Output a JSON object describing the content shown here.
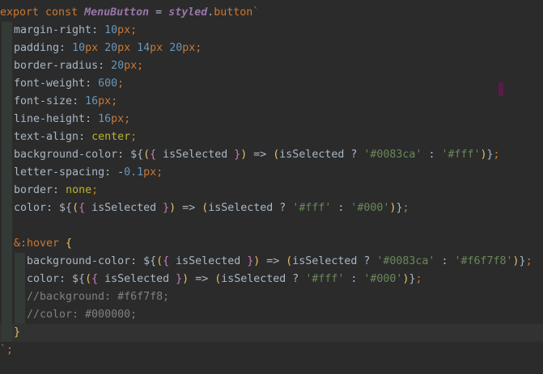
{
  "lines": [
    [
      [
        "kw",
        "export "
      ],
      [
        "kw",
        "const "
      ],
      [
        "fn",
        "MenuButton"
      ],
      [
        "plain",
        " = "
      ],
      [
        "fn",
        "styled"
      ],
      [
        "plain",
        "."
      ],
      [
        "kw",
        "button"
      ],
      [
        "tick",
        "`"
      ]
    ],
    [
      [
        "prop",
        "margin-right"
      ],
      [
        "plain",
        ": "
      ],
      [
        "num",
        "10"
      ],
      [
        "kw",
        "px"
      ],
      [
        "kw",
        ";"
      ]
    ],
    [
      [
        "prop",
        "padding"
      ],
      [
        "plain",
        ": "
      ],
      [
        "num",
        "10"
      ],
      [
        "kw",
        "px "
      ],
      [
        "num",
        "20"
      ],
      [
        "kw",
        "px "
      ],
      [
        "num",
        "14"
      ],
      [
        "kw",
        "px "
      ],
      [
        "num",
        "20"
      ],
      [
        "kw",
        "px"
      ],
      [
        "kw",
        ";"
      ]
    ],
    [
      [
        "prop",
        "border-radius"
      ],
      [
        "plain",
        ": "
      ],
      [
        "num",
        "20"
      ],
      [
        "kw",
        "px"
      ],
      [
        "kw",
        ";"
      ]
    ],
    [
      [
        "prop",
        "font-weight"
      ],
      [
        "plain",
        ": "
      ],
      [
        "num",
        "600"
      ],
      [
        "kw",
        ";"
      ]
    ],
    [
      [
        "prop",
        "font-size"
      ],
      [
        "plain",
        ": "
      ],
      [
        "num",
        "16"
      ],
      [
        "kw",
        "px"
      ],
      [
        "kw",
        ";"
      ]
    ],
    [
      [
        "prop",
        "line-height"
      ],
      [
        "plain",
        ": "
      ],
      [
        "num",
        "16"
      ],
      [
        "kw",
        "px"
      ],
      [
        "kw",
        ";"
      ]
    ],
    [
      [
        "prop",
        "text-align"
      ],
      [
        "plain",
        ": "
      ],
      [
        "val",
        "center"
      ],
      [
        "kw",
        ";"
      ]
    ],
    [
      [
        "prop",
        "background-color"
      ],
      [
        "plain",
        ": ${"
      ],
      [
        "br1",
        "("
      ],
      [
        "br2",
        "{ "
      ],
      [
        "plain",
        "isSelected "
      ],
      [
        "br2",
        "}"
      ],
      [
        "br1",
        ")"
      ],
      [
        "plain",
        " => "
      ],
      [
        "br1",
        "("
      ],
      [
        "plain",
        "isSelected ? "
      ],
      [
        "str",
        "'#0083ca'"
      ],
      [
        "plain",
        " : "
      ],
      [
        "str",
        "'#fff'"
      ],
      [
        "br1",
        ")"
      ],
      [
        "plain",
        "}"
      ],
      [
        "kw",
        ";"
      ]
    ],
    [
      [
        "prop",
        "letter-spacing"
      ],
      [
        "plain",
        ": -"
      ],
      [
        "num",
        "0.1"
      ],
      [
        "kw",
        "px"
      ],
      [
        "kw",
        ";"
      ]
    ],
    [
      [
        "prop",
        "border"
      ],
      [
        "plain",
        ": "
      ],
      [
        "val",
        "none"
      ],
      [
        "kw",
        ";"
      ]
    ],
    [
      [
        "prop",
        "color"
      ],
      [
        "plain",
        ": ${"
      ],
      [
        "br1",
        "("
      ],
      [
        "br2",
        "{ "
      ],
      [
        "plain",
        "isSelected "
      ],
      [
        "br2",
        "}"
      ],
      [
        "br1",
        ")"
      ],
      [
        "plain",
        " => "
      ],
      [
        "br1",
        "("
      ],
      [
        "plain",
        "isSelected ? "
      ],
      [
        "str",
        "'#fff'"
      ],
      [
        "plain",
        " : "
      ],
      [
        "str",
        "'#000'"
      ],
      [
        "br1",
        ")"
      ],
      [
        "plain",
        "}"
      ],
      [
        "kw",
        ";"
      ]
    ],
    [],
    [
      [
        "kw",
        "&:hover "
      ],
      [
        "br1",
        "{"
      ]
    ],
    [
      [
        "prop",
        "background-color"
      ],
      [
        "plain",
        ": ${"
      ],
      [
        "br1",
        "("
      ],
      [
        "br2",
        "{ "
      ],
      [
        "plain",
        "isSelected "
      ],
      [
        "br2",
        "}"
      ],
      [
        "br1",
        ")"
      ],
      [
        "plain",
        " => "
      ],
      [
        "br1",
        "("
      ],
      [
        "plain",
        "isSelected ? "
      ],
      [
        "str",
        "'#0083ca'"
      ],
      [
        "plain",
        " : "
      ],
      [
        "str",
        "'#f6f7f8'"
      ],
      [
        "br1",
        ")"
      ],
      [
        "plain",
        "}"
      ],
      [
        "kw",
        ";"
      ]
    ],
    [
      [
        "prop",
        "color"
      ],
      [
        "plain",
        ": ${"
      ],
      [
        "br1",
        "("
      ],
      [
        "br2",
        "{ "
      ],
      [
        "plain",
        "isSelected "
      ],
      [
        "br2",
        "}"
      ],
      [
        "br1",
        ")"
      ],
      [
        "plain",
        " => "
      ],
      [
        "br1",
        "("
      ],
      [
        "plain",
        "isSelected ? "
      ],
      [
        "str",
        "'#fff'"
      ],
      [
        "plain",
        " : "
      ],
      [
        "str",
        "'#000'"
      ],
      [
        "br1",
        ")"
      ],
      [
        "plain",
        "}"
      ],
      [
        "kw",
        ";"
      ]
    ],
    [
      [
        "cm",
        "//background: #f6f7f8;"
      ]
    ],
    [
      [
        "cm",
        "//color: #000000;"
      ]
    ],
    [
      [
        "br1",
        "}"
      ]
    ],
    [
      [
        "tick",
        "`"
      ],
      [
        "kw",
        ";"
      ]
    ]
  ]
}
